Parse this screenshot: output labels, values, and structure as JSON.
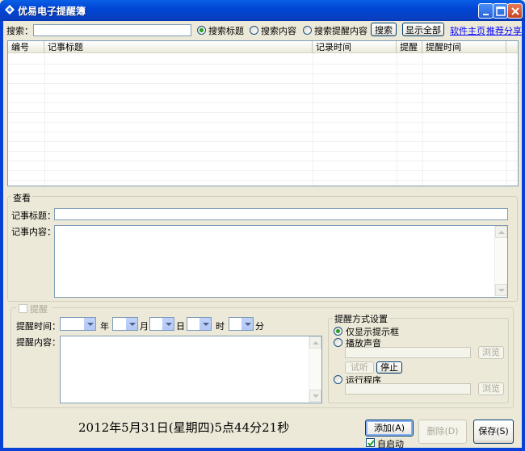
{
  "window": {
    "title": "优易电子提醒簿"
  },
  "search": {
    "label": "搜索：",
    "value": "",
    "options": [
      {
        "label": "搜索标题",
        "selected": true
      },
      {
        "label": "搜索内容",
        "selected": false
      },
      {
        "label": "搜索提醒内容",
        "selected": false
      }
    ],
    "search_button": "搜索",
    "show_all_button": "显示全部",
    "homepage_link": "软件主页",
    "share_link": "推荐分享"
  },
  "list": {
    "columns": [
      "编号",
      "记事标题",
      "记录时间",
      "提醒",
      "提醒时间"
    ],
    "rows": []
  },
  "view": {
    "group_title": "查看",
    "title_label": "记事标题：",
    "title_value": "",
    "content_label": "记事内容：",
    "content_value": ""
  },
  "reminder": {
    "checkbox_label": "提醒",
    "checked": false,
    "time_label": "提醒时间：",
    "year_unit": "年",
    "month_unit": "月",
    "day_unit": "日",
    "hour_unit": "时",
    "minute_unit": "分",
    "content_label": "提醒内容：",
    "content_value": ""
  },
  "method": {
    "group_title": "提醒方式设置",
    "options": [
      {
        "label": "仅显示提示框",
        "selected": true
      },
      {
        "label": "播放声音",
        "selected": false
      },
      {
        "label": "运行程序",
        "selected": false
      }
    ],
    "browse_label": "浏览",
    "test_label": "试听",
    "stop_label": "停止"
  },
  "footer": {
    "datetime": "2012年5月31日(星期四)5点44分21秒",
    "add_button": "添加(A)",
    "delete_button": "删除(D)",
    "save_button": "保存(S)",
    "autostart_label": "自启动",
    "autostart_checked": true
  },
  "colors": {
    "titlebar": "#0046D5",
    "face": "#ECE9D8",
    "link": "#0000FF"
  }
}
